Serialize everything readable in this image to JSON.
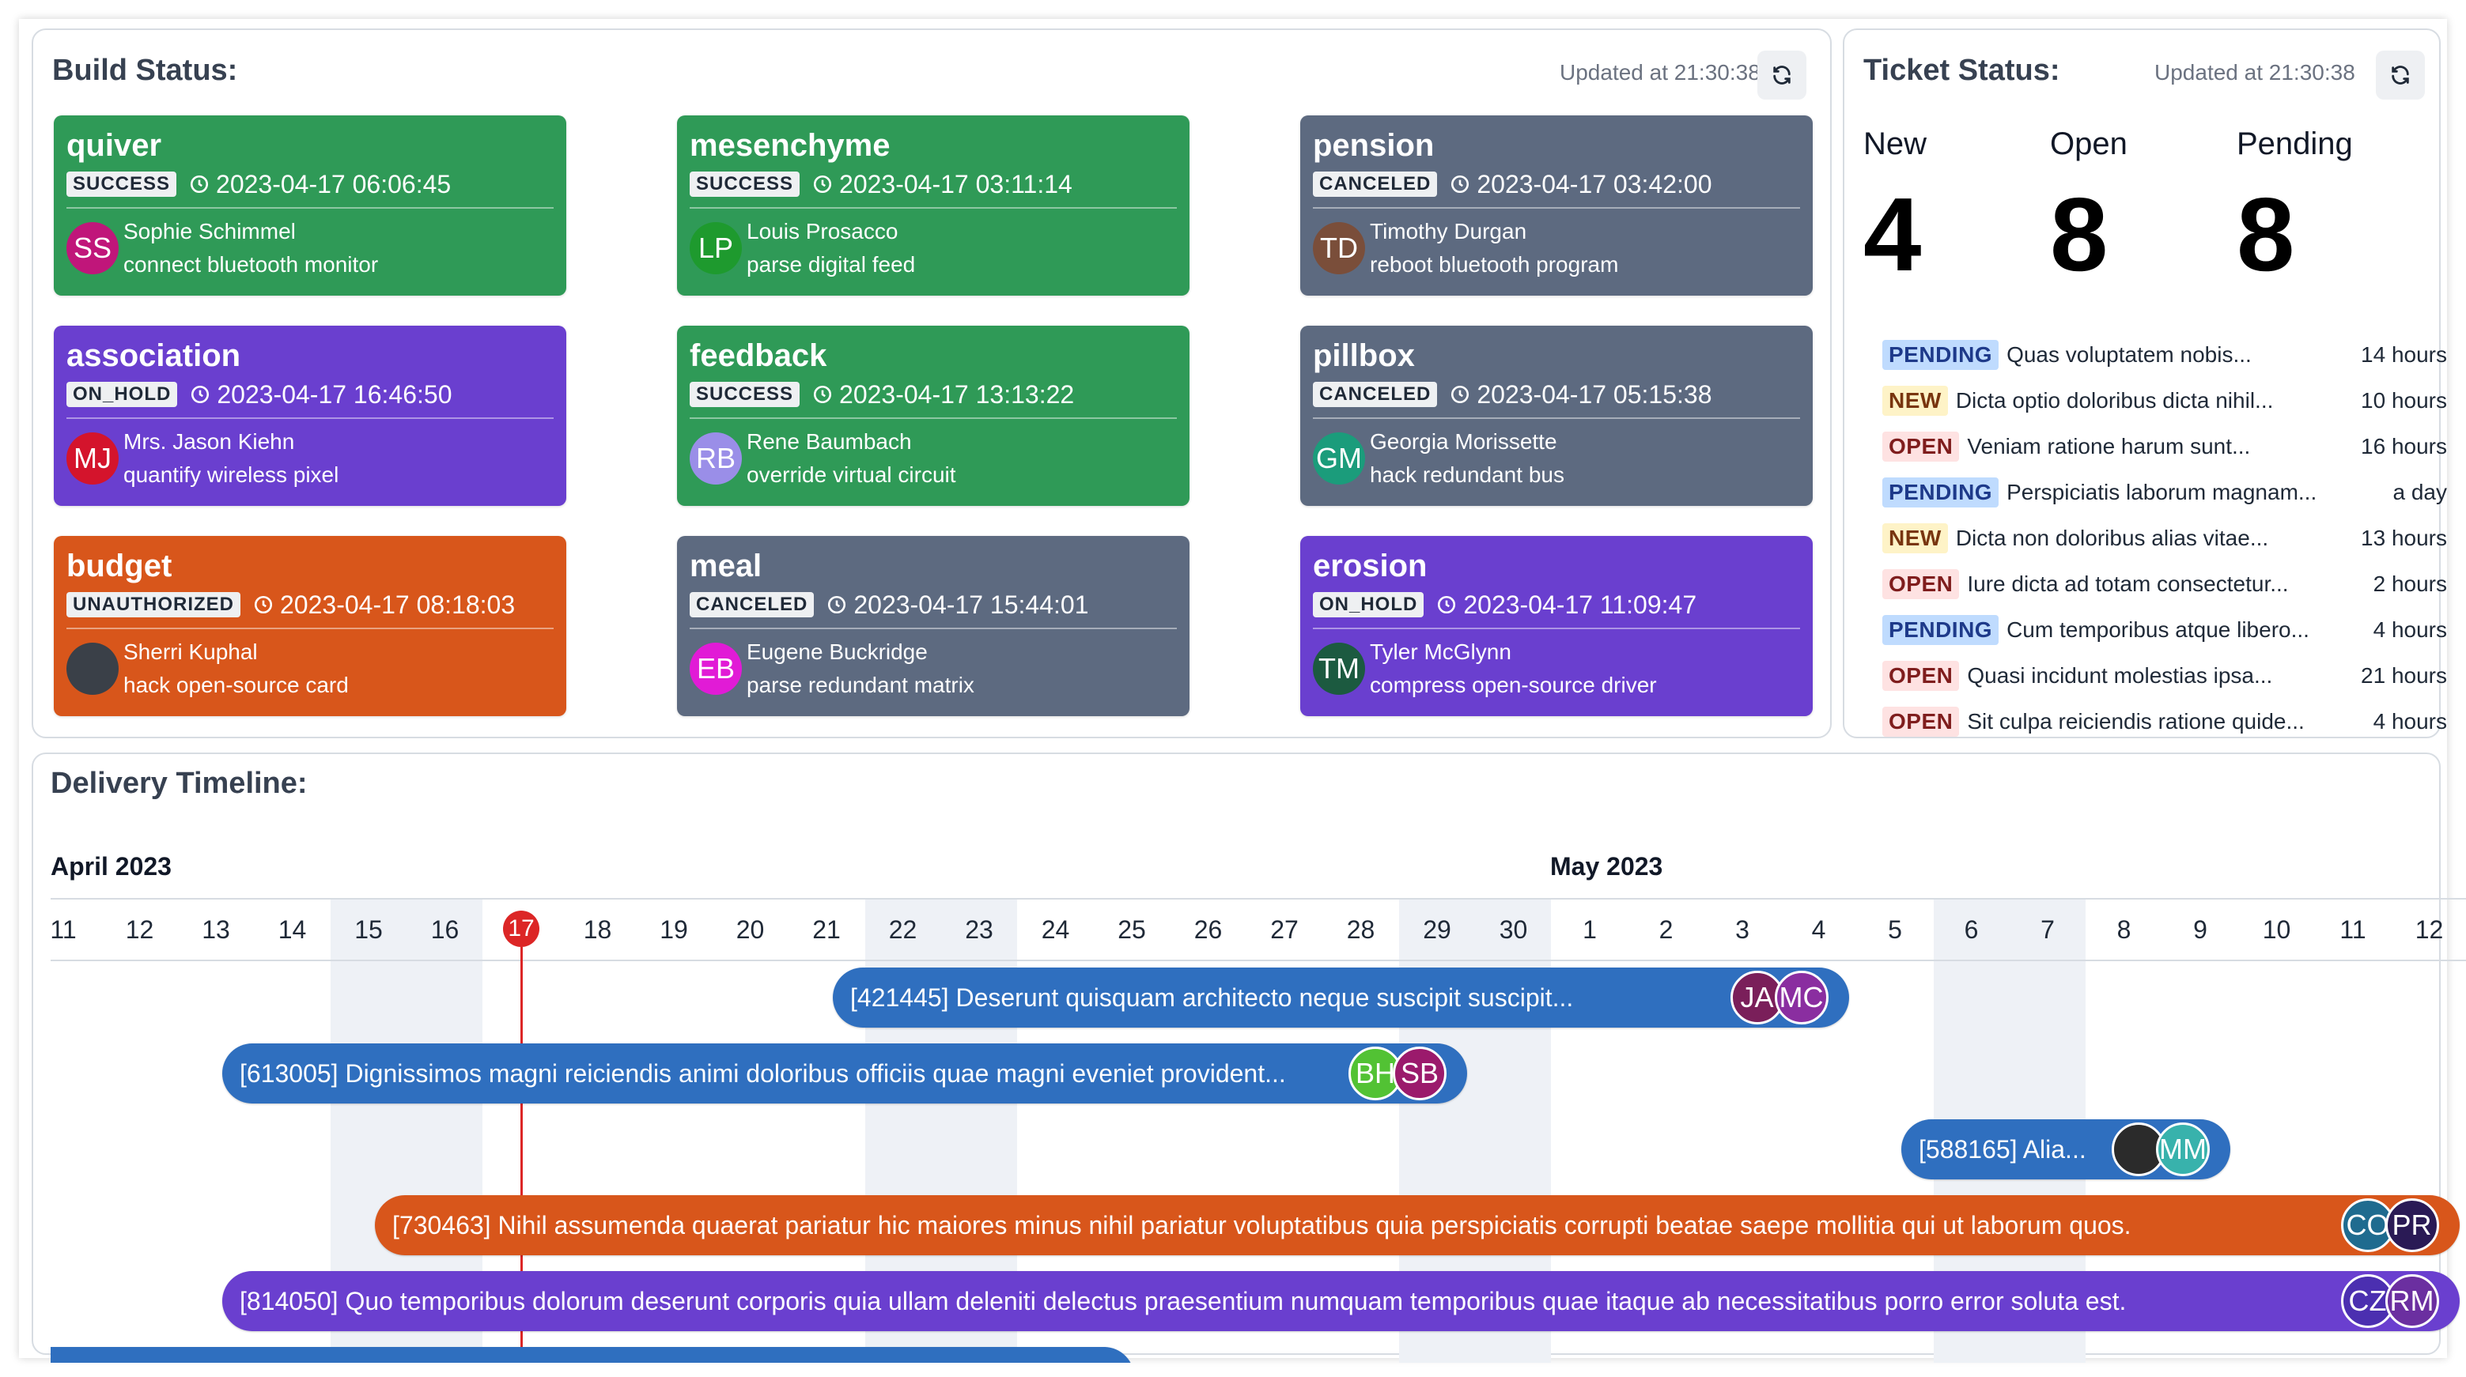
{
  "build": {
    "title": "Build Status:",
    "updated": "Updated at 21:30:38",
    "cards": [
      {
        "name": "quiver",
        "status": "SUCCESS",
        "ts": "2023-04-17 06:06:45",
        "initials": "SS",
        "user": "Sophie Schimmel",
        "task": "connect bluetooth monitor",
        "color": "#2f9a57",
        "avatar": "#c0167a"
      },
      {
        "name": "mesenchyme",
        "status": "SUCCESS",
        "ts": "2023-04-17 03:11:14",
        "initials": "LP",
        "user": "Louis Prosacco",
        "task": "parse digital feed",
        "color": "#2f9a57",
        "avatar": "#1e9a2e"
      },
      {
        "name": "pension",
        "status": "CANCELED",
        "ts": "2023-04-17 03:42:00",
        "initials": "TD",
        "user": "Timothy Durgan",
        "task": "reboot bluetooth program",
        "color": "#5d6a80",
        "avatar": "#7a4e3a"
      },
      {
        "name": "association",
        "status": "ON_HOLD",
        "ts": "2023-04-17 16:46:50",
        "initials": "MJ",
        "user": "Mrs. Jason Kiehn",
        "task": "quantify wireless pixel",
        "color": "#6a3fcf",
        "avatar": "#d4142c"
      },
      {
        "name": "feedback",
        "status": "SUCCESS",
        "ts": "2023-04-17 13:13:22",
        "initials": "RB",
        "user": "Rene Baumbach",
        "task": "override virtual circuit",
        "color": "#2f9a57",
        "avatar": "#9a8ee8"
      },
      {
        "name": "pillbox",
        "status": "CANCELED",
        "ts": "2023-04-17 05:15:38",
        "initials": "GM",
        "user": "Georgia Morissette",
        "task": "hack redundant bus",
        "color": "#5d6a80",
        "avatar": "#1b9c7b"
      },
      {
        "name": "budget",
        "status": "UNAUTHORIZED",
        "ts": "2023-04-17 08:18:03",
        "initials": "",
        "user": "Sherri Kuphal",
        "task": "hack open-source card",
        "color": "#d8561b",
        "avatar": "#3a4048"
      },
      {
        "name": "meal",
        "status": "CANCELED",
        "ts": "2023-04-17 15:44:01",
        "initials": "EB",
        "user": "Eugene Buckridge",
        "task": "parse redundant matrix",
        "color": "#5d6a80",
        "avatar": "#e11bd6"
      },
      {
        "name": "erosion",
        "status": "ON_HOLD",
        "ts": "2023-04-17 11:09:47",
        "initials": "TM",
        "user": "Tyler McGlynn",
        "task": "compress open-source driver",
        "color": "#6a3fcf",
        "avatar": "#1c5a40"
      }
    ]
  },
  "tickets": {
    "title": "Ticket Status:",
    "updated": "Updated at 21:30:38",
    "counts": [
      {
        "label": "New",
        "value": "4"
      },
      {
        "label": "Open",
        "value": "8"
      },
      {
        "label": "Pending",
        "value": "8"
      }
    ],
    "rows": [
      {
        "status": "PENDING",
        "subject": "Quas voluptatem nobis...",
        "ago": "14 hours"
      },
      {
        "status": "NEW",
        "subject": "Dicta optio doloribus dicta nihil...",
        "ago": "10 hours"
      },
      {
        "status": "OPEN",
        "subject": "Veniam ratione harum sunt...",
        "ago": "16 hours"
      },
      {
        "status": "PENDING",
        "subject": "Perspiciatis laborum magnam...",
        "ago": "a day"
      },
      {
        "status": "NEW",
        "subject": "Dicta non doloribus alias vitae...",
        "ago": "13 hours"
      },
      {
        "status": "OPEN",
        "subject": "Iure dicta ad totam consectetur...",
        "ago": "2 hours"
      },
      {
        "status": "PENDING",
        "subject": "Cum temporibus atque libero...",
        "ago": "4 hours"
      },
      {
        "status": "OPEN",
        "subject": "Quasi incidunt molestias ipsa...",
        "ago": "21 hours"
      },
      {
        "status": "OPEN",
        "subject": "Sit culpa reiciendis ratione quide...",
        "ago": "4 hours"
      }
    ],
    "badge_colors": {
      "PENDING": [
        "#bfdbfe",
        "#1e3a8a"
      ],
      "NEW": [
        "#fef3c7",
        "#78350f"
      ],
      "OPEN": [
        "#fee2e2",
        "#7f1d1d"
      ]
    }
  },
  "timeline": {
    "title": "Delivery Timeline:",
    "months": [
      "April 2023",
      "May 2023"
    ],
    "days": [
      "11",
      "12",
      "13",
      "14",
      "15",
      "16",
      "17",
      "18",
      "19",
      "20",
      "21",
      "22",
      "23",
      "24",
      "25",
      "26",
      "27",
      "28",
      "29",
      "30",
      "1",
      "2",
      "3",
      "4",
      "5",
      "6",
      "7",
      "8",
      "9",
      "10",
      "11",
      "12"
    ],
    "today": "17",
    "bars": [
      {
        "label": "[421445] Deserunt quisquam architecto neque suscipit suscipit...",
        "start": 10,
        "end": 23,
        "color": "#2f6fbf",
        "avatars": [
          {
            "i": "JA",
            "c": "#7a1f5a"
          },
          {
            "i": "MC",
            "c": "#8a2ea0"
          }
        ]
      },
      {
        "label": "[613005] Dignissimos magni reiciendis animi doloribus officiis quae magni eveniet provident...",
        "start": 2,
        "end": 18,
        "color": "#2f6fbf",
        "avatars": [
          {
            "i": "BH",
            "c": "#52c234"
          },
          {
            "i": "SB",
            "c": "#9b1a6c"
          }
        ]
      },
      {
        "label": "[588165] Alia...",
        "start": 24,
        "end": 28,
        "color": "#2f6fbf",
        "avatars": [
          {
            "i": "",
            "c": "#2b2b2b"
          },
          {
            "i": "MM",
            "c": "#38b2ac"
          }
        ]
      },
      {
        "label": "[730463] Nihil assumenda quaerat pariatur hic maiores minus nihil pariatur voluptatibus quia perspiciatis corrupti beatae saepe mollitia qui ut laborum quos.",
        "start": 4,
        "end": 31,
        "color": "#d8561b",
        "avatars": [
          {
            "i": "CO",
            "c": "#1f6b8f"
          },
          {
            "i": "PR",
            "c": "#2a1a55"
          }
        ]
      },
      {
        "label": "[814050] Quo temporibus dolorum deserunt corporis quia ullam deleniti delectus praesentium numquam temporibus quae itaque ab necessitatibus porro error soluta est.",
        "start": 2,
        "end": 31,
        "color": "#6a3fcf",
        "avatars": [
          {
            "i": "CZ",
            "c": "#4b2fb0"
          },
          {
            "i": "RM",
            "c": "#6b2fa0"
          }
        ]
      }
    ]
  }
}
